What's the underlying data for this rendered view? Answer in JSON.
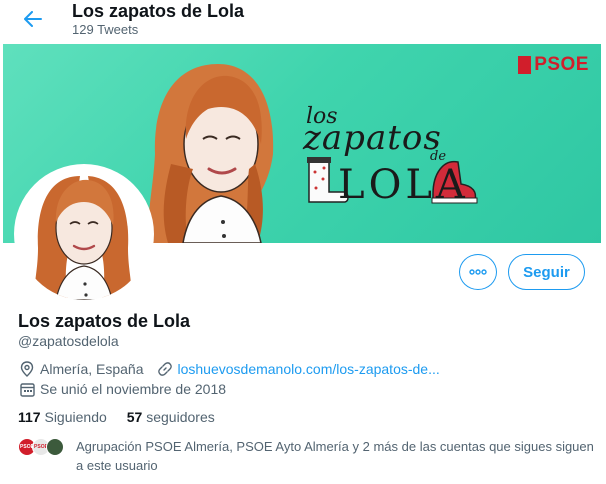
{
  "topbar": {
    "name": "Los zapatos de Lola",
    "tweet_count": "129 Tweets"
  },
  "banner": {
    "party_logo": "PSOE",
    "title_los": "los",
    "title_zapatos": "zapatos",
    "title_de": "de",
    "title_lola": "LOLA"
  },
  "actions": {
    "more_icon": "more-horizontal-icon",
    "follow_label": "Seguir"
  },
  "profile": {
    "name": "Los zapatos de Lola",
    "handle": "@zapatosdelola",
    "location": "Almería, España",
    "website": "loshuevosdemanolo.com/los-zapatos-de...",
    "joined": "Se unió el noviembre de 2018",
    "following_count": "117",
    "following_label": "Siguiendo",
    "followers_count": "57",
    "followers_label": "seguidores",
    "followers_you_know": "Agrupación PSOE Almería, PSOE Ayto Almería y 2 más de las cuentas que sigues siguen a este usuario"
  },
  "colors": {
    "accent": "#1d9bf0",
    "banner": "#3fd4ad",
    "psoe_red": "#d11e2b"
  }
}
